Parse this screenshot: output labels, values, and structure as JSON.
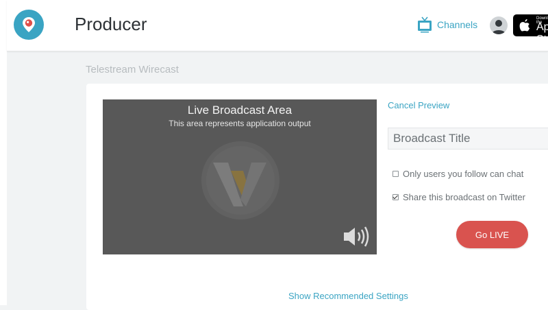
{
  "header": {
    "app_title": "Producer",
    "channels_label": "Channels",
    "appstore_small": "Download on the",
    "appstore_big": "App Store"
  },
  "source_label": "Telestream Wirecast",
  "preview": {
    "title": "Live Broadcast Area",
    "subtitle": "This area represents application output"
  },
  "controls": {
    "cancel_preview": "Cancel Preview",
    "broadcast_title_placeholder": "Broadcast Title",
    "option_followers_chat": "Only users you follow can chat",
    "option_followers_checked": false,
    "option_share_twitter": "Share this broadcast on Twitter",
    "option_twitter_checked": true,
    "go_live": "Go LIVE"
  },
  "footer_link": "Show Recommended Settings",
  "colors": {
    "accent": "#3aa4c3",
    "go_live": "#d9534f",
    "preview_bg": "#585858"
  },
  "icons": [
    "periscope-logo-icon",
    "tv-icon",
    "avatar-icon",
    "apple-icon",
    "wirecast-logo-icon",
    "speaker-icon"
  ]
}
